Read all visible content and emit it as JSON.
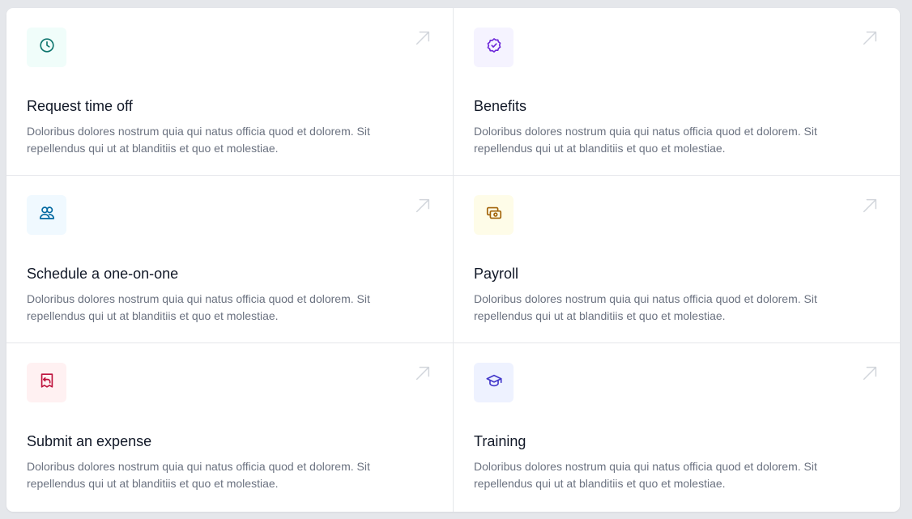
{
  "actions": [
    {
      "title": "Request time off",
      "description": "Doloribus dolores nostrum quia qui natus officia quod et dolorem. Sit repellendus qui ut at blanditiis et quo et molestiae.",
      "icon": "clock-icon",
      "icon_bg": "#f0fdfa",
      "icon_color": "#0f766e"
    },
    {
      "title": "Benefits",
      "description": "Doloribus dolores nostrum quia qui natus officia quod et dolorem. Sit repellendus qui ut at blanditiis et quo et molestiae.",
      "icon": "check-badge-icon",
      "icon_bg": "#f5f3ff",
      "icon_color": "#6d28d9"
    },
    {
      "title": "Schedule a one-on-one",
      "description": "Doloribus dolores nostrum quia qui natus officia quod et dolorem. Sit repellendus qui ut at blanditiis et quo et molestiae.",
      "icon": "users-icon",
      "icon_bg": "#f0f9ff",
      "icon_color": "#0369a1"
    },
    {
      "title": "Payroll",
      "description": "Doloribus dolores nostrum quia qui natus officia quod et dolorem. Sit repellendus qui ut at blanditiis et quo et molestiae.",
      "icon": "banknotes-icon",
      "icon_bg": "#fefce8",
      "icon_color": "#a16207"
    },
    {
      "title": "Submit an expense",
      "description": "Doloribus dolores nostrum quia qui natus officia quod et dolorem. Sit repellendus qui ut at blanditiis et quo et molestiae.",
      "icon": "receipt-refund-icon",
      "icon_bg": "#fff1f2",
      "icon_color": "#be123c"
    },
    {
      "title": "Training",
      "description": "Doloribus dolores nostrum quia qui natus officia quod et dolorem. Sit repellendus qui ut at blanditiis et quo et molestiae.",
      "icon": "academic-cap-icon",
      "icon_bg": "#eef2ff",
      "icon_color": "#4338ca"
    }
  ],
  "arrow_icon": "arrow-up-right-icon",
  "arrow_color": "#d1d5db"
}
